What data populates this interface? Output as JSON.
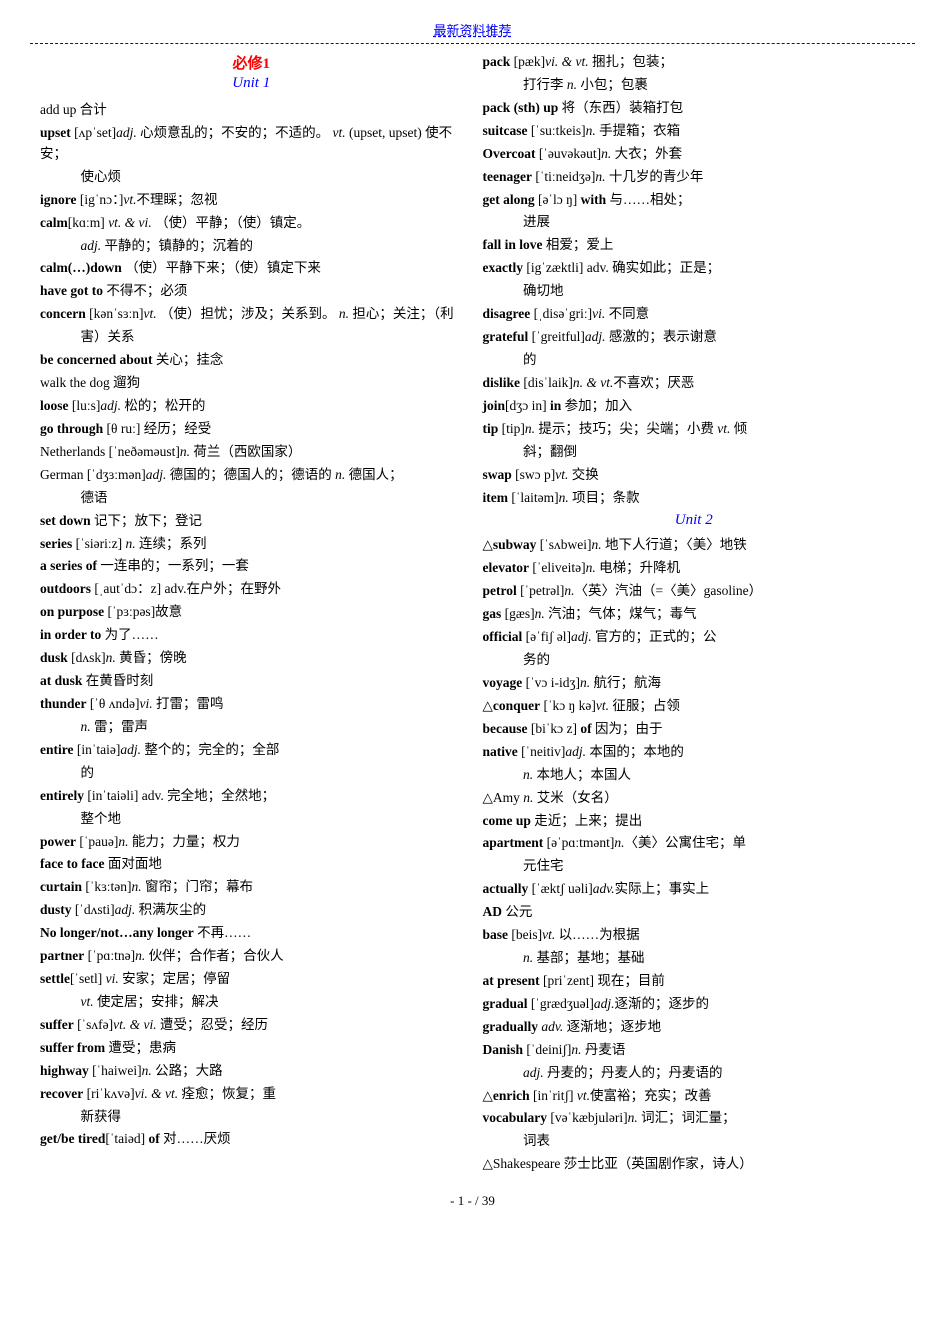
{
  "topLink": "最新资料推荐",
  "left": {
    "unitTitle": "必修1",
    "unitSubtitle": "Unit 1",
    "entries": [
      {
        "text": "add up 合计"
      },
      {
        "text": "upset [ʌpˈset]adj. 心烦意乱的；不安的；不适的。 vt. (upset, upset) 使不安；使心烦",
        "indent": false,
        "indent2": true
      },
      {
        "text": "ignore [igˈnɔ：]vt.不理睬；忽视"
      },
      {
        "text": "calm[kɑːm] vt. & vi. （使）平静；（使）镇定。",
        "indent": false
      },
      {
        "text": "adj. 平静的；镇静的；沉着的",
        "indent2": true
      },
      {
        "text": "calm(…)down （使）平静下来；（使）镇定下来",
        "indent": false
      },
      {
        "text": "have got to 不得不；必须"
      },
      {
        "text": "concern [kənˈsɜːn]vt. （使）担忧；涉及；关系到。 n. 担心；关注；（利害）关系",
        "indent": false,
        "indent2": true
      },
      {
        "text": "be concerned about 关心；挂念"
      },
      {
        "text": "walk the dog 遛狗"
      },
      {
        "text": "loose [luːs]adj. 松的；松开的"
      },
      {
        "text": "go through [θ ruː] 经历；经受"
      },
      {
        "text": "Netherlands [ˈneðəməust]n. 荷兰（西欧国家）"
      },
      {
        "text": "German [ˈdʒɜːmən]adj. 德国的；德国人的；德语的 n. 德国人；德语",
        "indent2": true
      },
      {
        "text": "set down 记下；放下；登记"
      },
      {
        "text": "series [ˈsiəriːz] n. 连续；系列"
      },
      {
        "text": "a series of 一连串的；一系列；一套"
      },
      {
        "text": "outdoors [ˌautˈdɔ：z] adv.在户外；在野外"
      },
      {
        "text": "on purpose [ˈpɜːpəs]故意"
      },
      {
        "text": "in order to 为了……"
      },
      {
        "text": "dusk [dʌsk]n. 黄昏；傍晚"
      },
      {
        "text": "at dusk 在黄昏时刻"
      },
      {
        "text": "thunder [ˈθ ʌndə]vi. 打雷；雷鸣",
        "indent": false
      },
      {
        "text": "n. 雷；雷声",
        "indent2": true
      },
      {
        "text": "entire [inˈtaiə]adj. 整个的；完全的；全部的",
        "indent": false,
        "indent2": true
      },
      {
        "text": "entirely [inˈtaiəli] adv. 完全地；全然地；整个地",
        "indent": false,
        "indent2": true
      },
      {
        "text": "power [ˈpauə]n. 能力；力量；权力"
      },
      {
        "text": "face to face 面对面地"
      },
      {
        "text": "curtain [ˈkɜːtən]n. 窗帘；门帘；幕布"
      },
      {
        "text": "dusty [ˈdʌsti]adj. 积满灰尘的"
      },
      {
        "text": "No longer/not…any longer 不再……"
      },
      {
        "text": "partner [ˈpɑːtnə]n. 伙伴；合作者；合伙人"
      },
      {
        "text": "settle[ˈsetl] vi. 安家；定居；停留",
        "indent": false
      },
      {
        "text": "vt. 使定居；安排；解决",
        "indent2": true
      },
      {
        "text": "suffer [ˈsʌfə]vt. & vi. 遭受；忍受；经历"
      },
      {
        "text": "suffer from 遭受；患病"
      },
      {
        "text": "highway [ˈhaiwei]n. 公路；大路"
      },
      {
        "text": "recover [riˈkʌvə]vi. & vt. 痊愈；恢复；重新获得",
        "indent2": true
      },
      {
        "text": "get/be tired[ˈtaiəd] of 对……厌烦"
      }
    ]
  },
  "right": {
    "entries_top": [
      {
        "text": "pack [pæk]vi. & vt. 捆扎；包装；",
        "bold": "pack"
      },
      {
        "text": "打行李  n. 小包；包裹",
        "indent2": true
      },
      {
        "text": "pack (sth) up 将（东西）装箱打包"
      },
      {
        "text": "suitcase [ˈsuːtkeis]n. 手提箱；衣箱"
      },
      {
        "text": "Overcoat [ˈəuvəkəut]n. 大衣；外套"
      },
      {
        "text": "teenager [ˈtiːneidʒə]n. 十几岁的青少年"
      },
      {
        "text": "get along [əˈlɔ ŋ] with 与……相处；",
        "indent": false
      },
      {
        "text": "进展",
        "indent2": true
      },
      {
        "text": "fall in love 相爱；爱上"
      },
      {
        "text": "exactly [igˈzæktli] adv. 确实如此；正是；",
        "indent": false
      },
      {
        "text": "确切地",
        "indent2": true
      },
      {
        "text": "disagree [ˌdisəˈgriː]vi. 不同意"
      },
      {
        "text": "grateful [ˈgreitful]adj. 感激的；表示谢意的",
        "indent2": true
      },
      {
        "text": "dislike [disˈlaik]n. & vt.不喜欢；厌恶"
      },
      {
        "text": "join[dʒɔ in] in 参加；加入"
      },
      {
        "text": "tip [tip]n. 提示；技巧；尖；尖端；小费 vt. 倾斜；翻倒",
        "indent2": true
      },
      {
        "text": "swap [swɔ p]vt. 交换"
      },
      {
        "text": "item [ˈlaitəm]n. 项目；条款"
      }
    ],
    "unit2Title": "Unit 2",
    "entries_bottom": [
      {
        "text": "△subway [ˈsʌbwei]n. 地下人行道；〈美〉地铁"
      },
      {
        "text": "elevator [ˈeliveitə]n. 电梯；升降机"
      },
      {
        "text": "petrol [ˈpetrəl]n.〈英〉汽油（=〈美〉gasoline）"
      },
      {
        "text": "gas [gæs]n. 汽油；气体；煤气；毒气"
      },
      {
        "text": "official [əˈfiʃ əl]adj. 官方的；正式的；公务的",
        "indent2": true
      },
      {
        "text": "voyage [ˈvɔ i-idʒ]n. 航行；航海"
      },
      {
        "text": "△conquer [ˈkɔ ŋ kə]vt. 征服；占领"
      },
      {
        "text": "because [biˈkɔ z] of 因为；由于"
      },
      {
        "text": "native [ˈneitiv]adj. 本国的；本地的",
        "indent": false
      },
      {
        "text": "n. 本地人；本国人",
        "indent2": true
      },
      {
        "text": "△Amy n. 艾米（女名）"
      },
      {
        "text": "come up 走近；上来；提出"
      },
      {
        "text": "apartment [əˈpɑːtmənt]n.〈美〉公寓住宅；单元住宅",
        "indent2": true
      },
      {
        "text": "actually [ˈæktʃ uəli]adv.实际上；事实上"
      },
      {
        "text": "AD 公元"
      },
      {
        "text": "base [beis]vt. 以……为根据",
        "indent": false
      },
      {
        "text": "n. 基部；基地；基础",
        "indent2": true
      },
      {
        "text": "at present [priˈzent] 现在；目前"
      },
      {
        "text": "gradual [ˈgrædʒuəl]adj.逐渐的；逐步的"
      },
      {
        "text": "gradually adv. 逐渐地；逐步地"
      },
      {
        "text": "Danish [ˈdeiniʃ]n. 丹麦语",
        "indent": false
      },
      {
        "text": "adj. 丹麦的；丹麦人的；丹麦语的",
        "indent2": true
      },
      {
        "text": "△enrich [inˈritʃ] vt.使富裕；充实；改善"
      },
      {
        "text": "vocabulary [vəˈkæbjuləri]n. 词汇；词汇量；词表",
        "indent2": true
      },
      {
        "text": "△Shakespeare 莎士比亚（英国剧作家，诗人）"
      }
    ]
  },
  "pageNum": "- 1 - / 39"
}
